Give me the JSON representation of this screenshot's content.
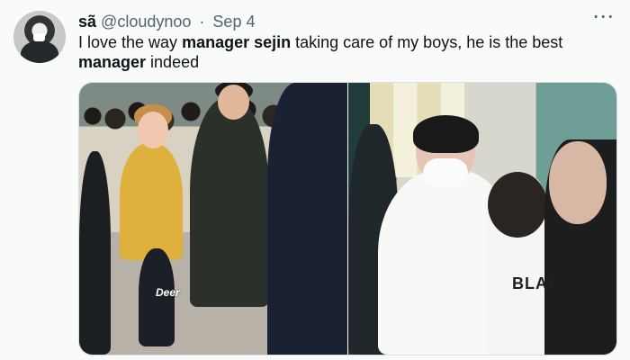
{
  "tweet": {
    "display_name": "sã",
    "handle": "@cloudynoo",
    "dot": "·",
    "date": "Sep 4",
    "more_icon": "⋯",
    "text": {
      "part1": "I love the way ",
      "part2": "manager sejin",
      "part3": " taking care of my boys, he is the best ",
      "part4": "manager",
      "part5": " indeed"
    }
  },
  "media": {
    "watermark": "Deer",
    "shirt_text": "BLAC"
  },
  "colors": {
    "background": "#f9fafa",
    "text": "#0f1419",
    "secondary_text": "#536471"
  }
}
